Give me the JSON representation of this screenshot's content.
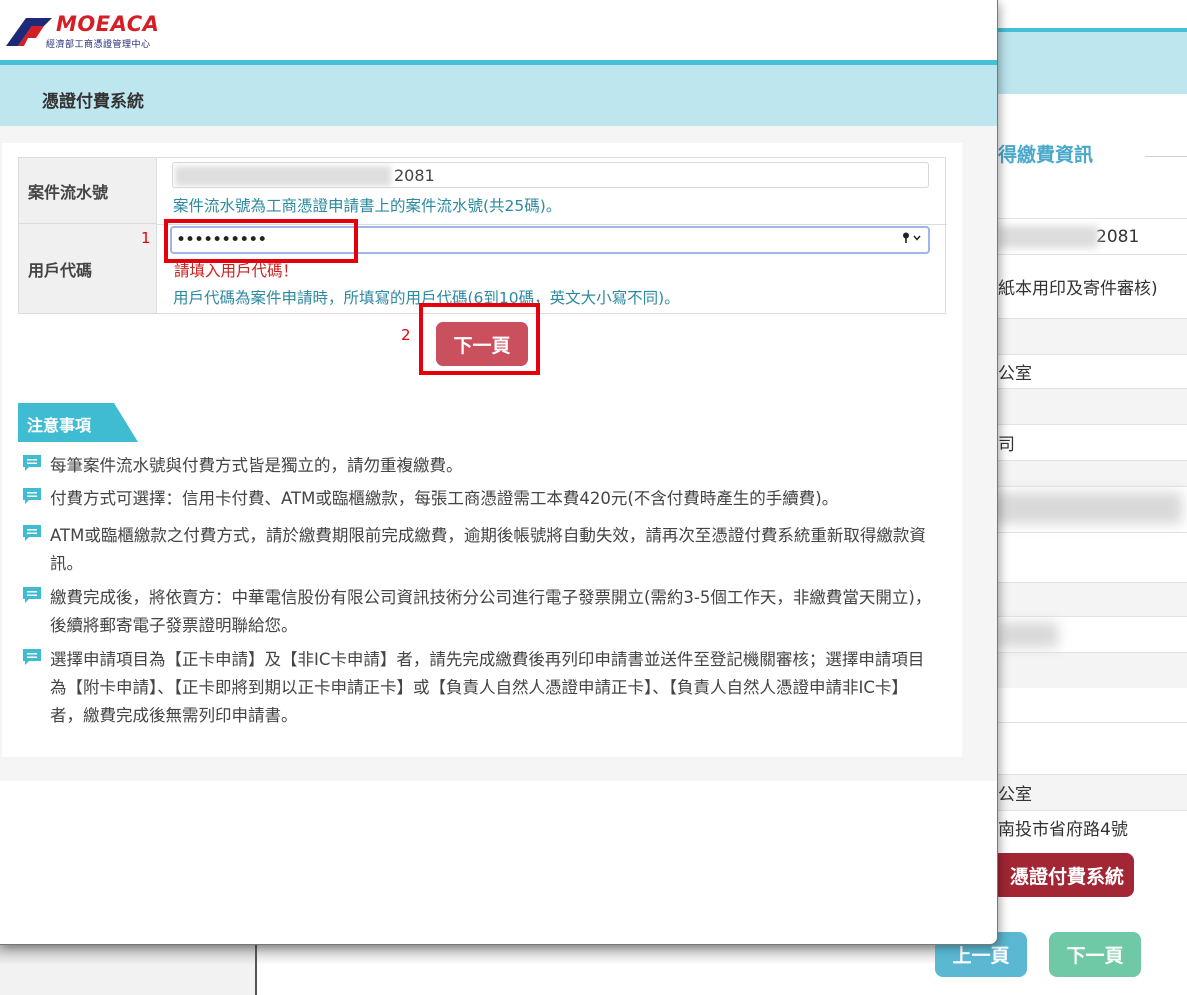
{
  "background": {
    "section_title": "得繳費資訊",
    "rows": [
      {
        "text": "2081"
      },
      {
        "text": "紙本用印及寄件審核)"
      },
      {
        "text": ""
      },
      {
        "text": "公室"
      },
      {
        "text": ""
      },
      {
        "text": "司"
      },
      {
        "text": ""
      },
      {
        "text": ""
      },
      {
        "text": ""
      },
      {
        "text": ""
      },
      {
        "text": ""
      },
      {
        "text": ""
      },
      {
        "text": "公室"
      },
      {
        "text": "南投市省府路4號"
      }
    ],
    "pay_button": "憑證付費系統",
    "prev_button": "上一頁",
    "next_button": "下一頁"
  },
  "logo": {
    "name": "MOEACA",
    "subtitle": "經濟部工商憑證管理中心"
  },
  "modal": {
    "title": "憑證付費系統",
    "form": {
      "case_label": "案件流水號",
      "case_value": "2081",
      "case_hint": "案件流水號為工商憑證申請書上的案件流水號(共25碼)。",
      "user_label": "用戶代碼",
      "user_value": "••••••••••",
      "user_error": "請填入用戶代碼！",
      "user_hint": "用戶代碼為案件申請時，所填寫的用戶代碼(6到10碼，英文大小寫不同)。"
    },
    "annotations": {
      "mark1": "1",
      "mark2": "2"
    },
    "next_button": "下一頁",
    "notice": {
      "title": "注意事項",
      "items": [
        "每筆案件流水號與付費方式皆是獨立的，請勿重複繳費。",
        "付費方式可選擇：信用卡付費、ATM或臨櫃繳款，每張工商憑證需工本費420元(不含付費時產生的手續費)。",
        "ATM或臨櫃繳款之付費方式，請於繳費期限前完成繳費，逾期後帳號將自動失效，請再次至憑證付費系統重新取得繳款資訊。",
        "繳費完成後，將依賣方：中華電信股份有限公司資訊技術分公司進行電子發票開立(需約3-5個工作天，非繳費當天開立)，後續將郵寄電子發票證明聯給您。",
        "選擇申請項目為【正卡申請】及【非IC卡申請】者，請先完成繳費後再列印申請書並送件至登記機關審核；選擇申請項目為【附卡申請】、【正卡即將到期以正卡申請正卡】或【負責人自然人憑證申請正卡】、【負責人自然人憑證申請非IC卡】者，繳費完成後無需列印申請書。"
      ]
    }
  },
  "colors": {
    "header_bg": "#bde6ee",
    "header_border": "#46c0d6",
    "hint_text": "#2c8aa0",
    "error_text": "#cc1f1f",
    "next_button": "#c9505c",
    "annotation": "#e6000d"
  }
}
